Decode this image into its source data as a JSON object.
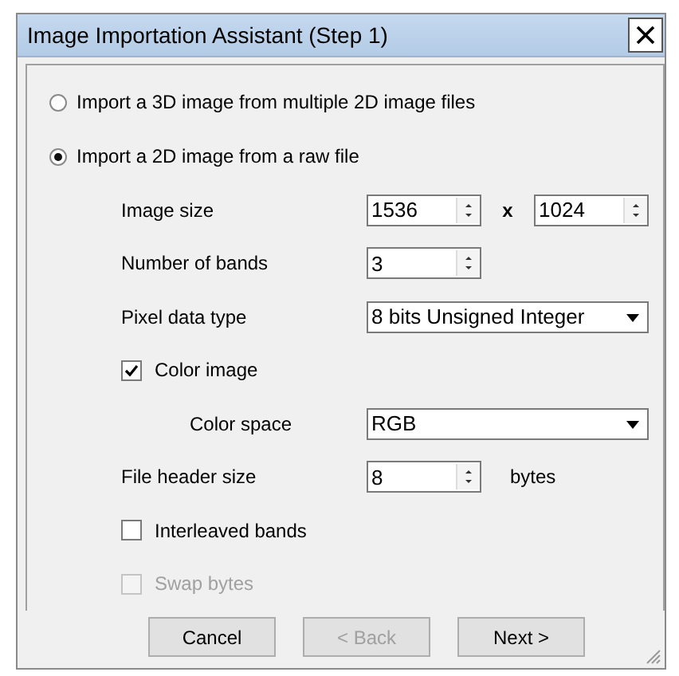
{
  "window": {
    "title": "Image Importation Assistant (Step 1)"
  },
  "radios": [
    {
      "label": "Import a 3D image from multiple 2D image files",
      "selected": false
    },
    {
      "label": "Import a 2D image from a raw file",
      "selected": true
    }
  ],
  "fields": [
    {
      "kind": "size",
      "label": "Image size",
      "value": "1536",
      "separator": "x",
      "value2": "1024"
    },
    {
      "kind": "spinner",
      "label": "Number of bands",
      "value": "3"
    },
    {
      "kind": "dropdown",
      "label": "Pixel data type",
      "value": "8 bits Unsigned Integer"
    },
    {
      "kind": "checkbox",
      "label": "Color image",
      "checked": true,
      "disabled": false,
      "children": [
        {
          "kind": "dropdown",
          "label": "Color space",
          "value": "RGB"
        }
      ]
    },
    {
      "kind": "spinner",
      "label": "File header size",
      "value": "8",
      "unit": "bytes"
    },
    {
      "kind": "checkbox",
      "label": "Interleaved bands",
      "checked": false,
      "disabled": false
    },
    {
      "kind": "checkbox",
      "label": "Swap bytes",
      "checked": false,
      "disabled": true
    }
  ],
  "buttons": [
    {
      "label": "Cancel",
      "disabled": false
    },
    {
      "label": "< Back",
      "disabled": true
    },
    {
      "label": "Next >",
      "disabled": false
    }
  ]
}
